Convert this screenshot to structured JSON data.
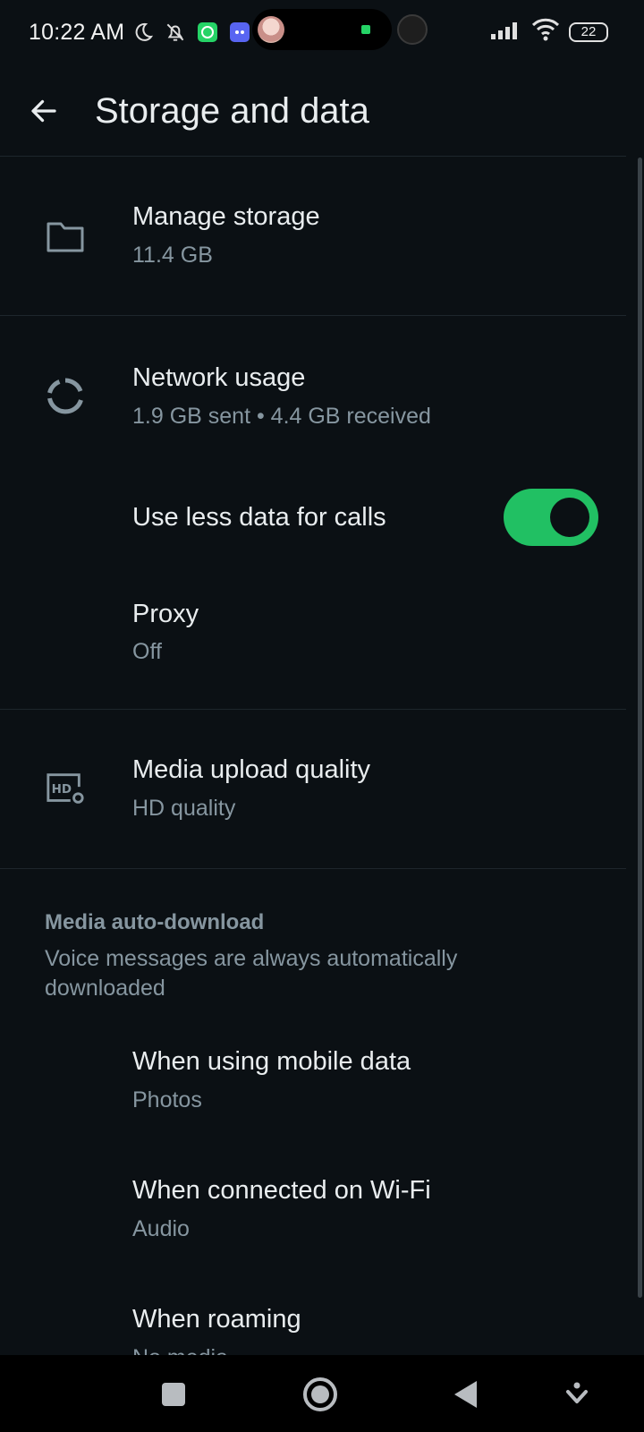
{
  "status_bar": {
    "time": "10:22 AM",
    "left_icons": [
      "moon-icon",
      "bell-off-icon",
      "whatsapp-icon",
      "discord-icon"
    ],
    "battery": "22"
  },
  "header": {
    "title": "Storage and data"
  },
  "items": {
    "manage_storage": {
      "title": "Manage storage",
      "subtitle": "11.4 GB"
    },
    "network_usage": {
      "title": "Network usage",
      "subtitle": "1.9 GB sent • 4.4 GB received"
    },
    "less_data_calls": {
      "title": "Use less data for calls",
      "enabled": true
    },
    "proxy": {
      "title": "Proxy",
      "subtitle": "Off"
    },
    "media_upload": {
      "title": "Media upload quality",
      "subtitle": "HD quality"
    }
  },
  "auto_download": {
    "header": "Media auto-download",
    "description": "Voice messages are always automatically downloaded",
    "mobile_data": {
      "title": "When using mobile data",
      "subtitle": "Photos"
    },
    "wifi": {
      "title": "When connected on Wi-Fi",
      "subtitle": "Audio"
    },
    "roaming": {
      "title": "When roaming",
      "subtitle": "No media"
    }
  },
  "colors": {
    "background": "#0b1014",
    "accent": "#21c063",
    "primary_text": "#e9edef",
    "secondary_text": "#8696a0"
  }
}
